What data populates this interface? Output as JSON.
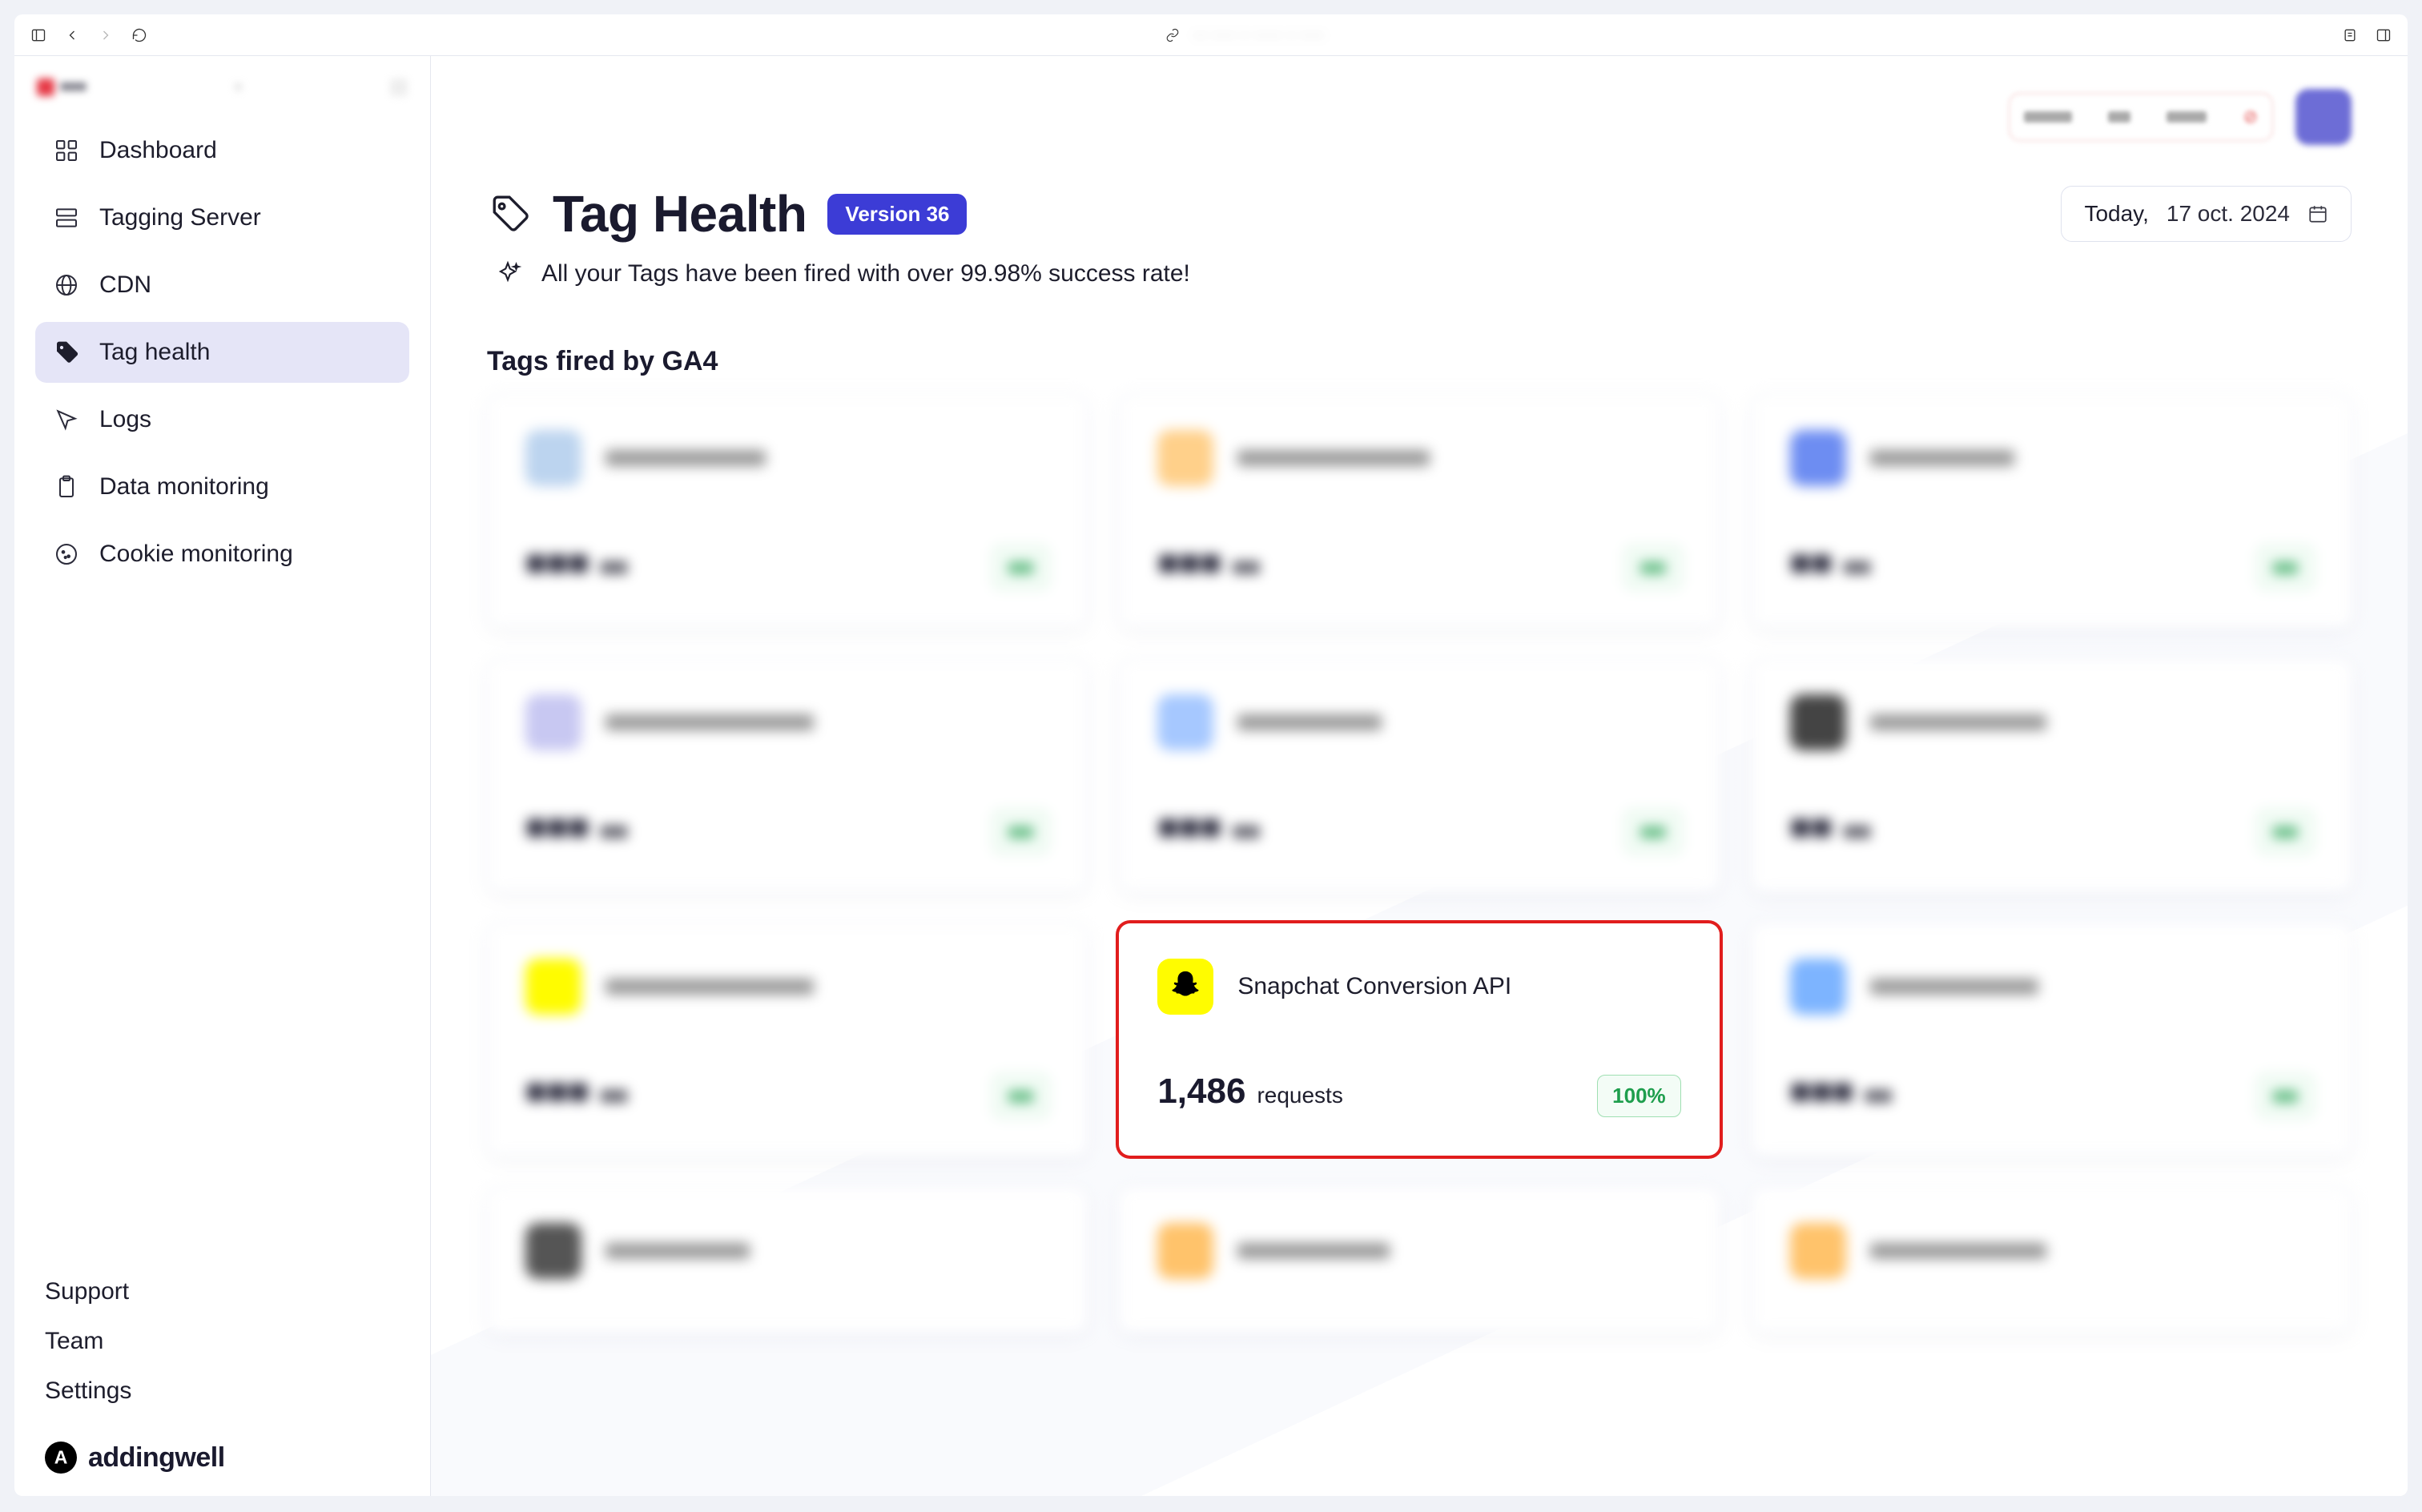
{
  "browser": {
    "url_blurred": "··· ····· ·· ······ ·· ·····"
  },
  "sidebar": {
    "items": [
      {
        "label": "Dashboard"
      },
      {
        "label": "Tagging Server"
      },
      {
        "label": "CDN"
      },
      {
        "label": "Tag health"
      },
      {
        "label": "Logs"
      },
      {
        "label": "Data monitoring"
      },
      {
        "label": "Cookie monitoring"
      }
    ],
    "footer": {
      "support": "Support",
      "team": "Team",
      "settings": "Settings",
      "brand": "addingwell"
    }
  },
  "header": {
    "title": "Tag Health",
    "version": "Version 36",
    "date_prefix": "Today,",
    "date": "17 oct. 2024"
  },
  "subtitle": "All your Tags have been fired with over 99.98% success rate!",
  "section_title": "Tags fired by GA4",
  "highlight_card": {
    "title": "Snapchat Conversion API",
    "requests_value": "1,486",
    "requests_label": "requests",
    "success_pct": "100%"
  }
}
